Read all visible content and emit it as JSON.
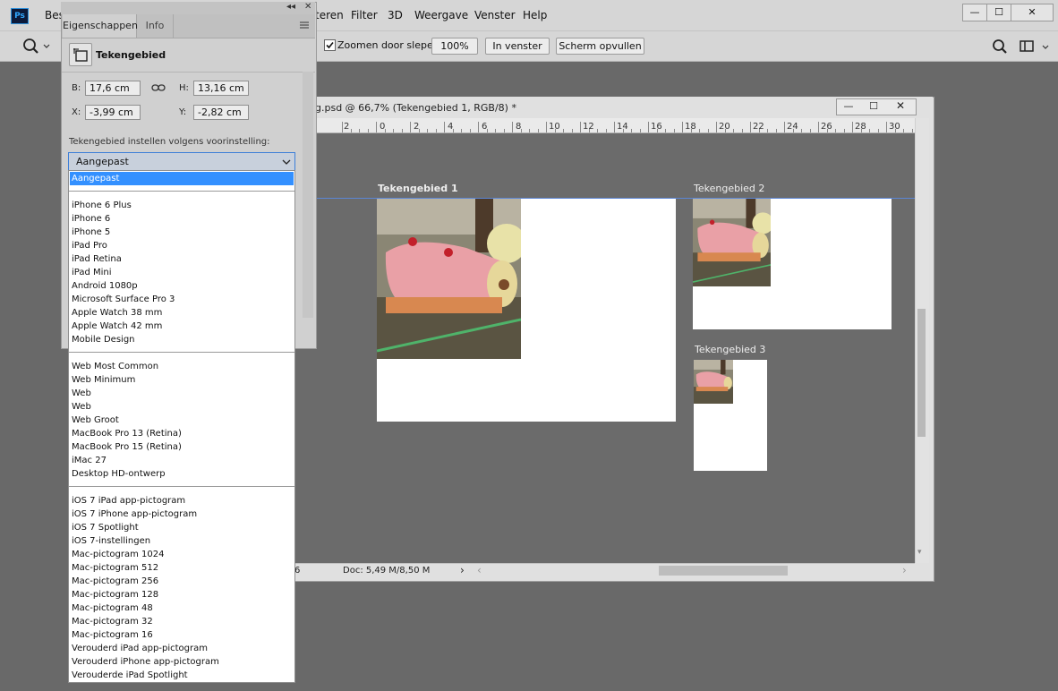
{
  "menu": {
    "items": [
      "Bes",
      "teren",
      "Filter",
      "3D",
      "Weergave",
      "Venster",
      "Help"
    ],
    "app_icon": "Ps"
  },
  "window_controls": {
    "minimize": "—",
    "maximize": "☐",
    "close": "✕"
  },
  "options_bar": {
    "zoom_drag_label": "Zoomen door slepen",
    "zoom_drag_checked": true,
    "btn_100": "100%",
    "btn_fit": "In venster",
    "btn_fill": "Scherm opvullen"
  },
  "document": {
    "title": "g.psd @ 66,7% (Tekengebied 1, RGB/8) *",
    "ruler_ticks": [
      "2",
      "0",
      "2",
      "4",
      "6",
      "8",
      "10",
      "12",
      "14",
      "16",
      "18",
      "20",
      "22",
      "24",
      "26",
      "28",
      "30"
    ],
    "status_zoom_fragment": "6",
    "status_doc": "Doc: 5,49 M/8,50 M",
    "artboards": [
      {
        "label": "Tekengebied 1"
      },
      {
        "label": "Tekengebied 2"
      },
      {
        "label": "Tekengebied 3"
      }
    ]
  },
  "panel": {
    "tabs": [
      "Eigenschappen",
      "Info"
    ],
    "header": "Tekengebied",
    "fields": {
      "w_label": "B:",
      "w_value": "17,6 cm",
      "h_label": "H:",
      "h_value": "13,16 cm",
      "x_label": "X:",
      "x_value": "-3,99 cm",
      "y_label": "Y:",
      "y_value": "-2,82 cm"
    },
    "preset_label": "Tekengebied instellen volgens voorinstelling:",
    "preset_value": "Aangepast"
  },
  "dropdown": {
    "selected": "Aangepast",
    "group_mobile": [
      "iPhone 6 Plus",
      "iPhone 6",
      "iPhone 5",
      "iPad Pro",
      "iPad Retina",
      "iPad Mini",
      "Android 1080p",
      "Microsoft Surface Pro 3",
      "Apple Watch 38 mm",
      "Apple Watch 42 mm",
      "Mobile Design"
    ],
    "group_web": [
      "Web Most Common",
      "Web Minimum",
      "Web",
      "Web",
      "Web Groot",
      "MacBook Pro 13 (Retina)",
      "MacBook Pro 15 (Retina)",
      "iMac 27",
      "Desktop HD-ontwerp"
    ],
    "group_icons": [
      "iOS 7 iPad app-pictogram",
      "iOS 7 iPhone app-pictogram",
      "iOS 7 Spotlight",
      "iOS 7-instellingen",
      "Mac-pictogram 1024",
      "Mac-pictogram 512",
      "Mac-pictogram 256",
      "Mac-pictogram 128",
      "Mac-pictogram 48",
      "Mac-pictogram 32",
      "Mac-pictogram 16",
      "Verouderd iPad app-pictogram",
      "Verouderd iPhone app-pictogram",
      "Verouderde iPad Spotlight"
    ]
  }
}
